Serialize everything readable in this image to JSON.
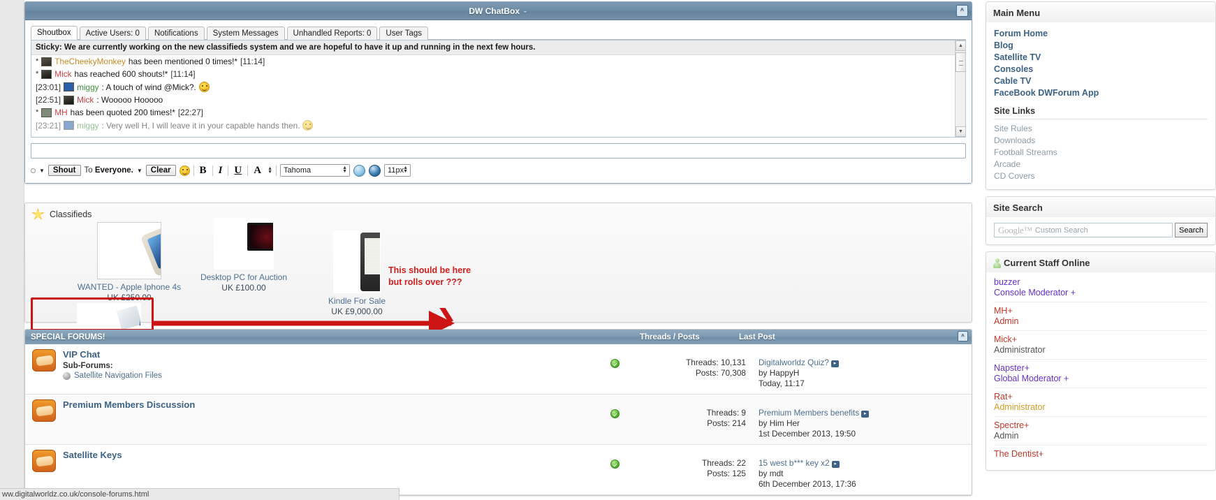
{
  "chatbox": {
    "title": "DW ChatBox",
    "title_caret": "⌄",
    "collapse_label": "^",
    "tabs": [
      {
        "label": "Shoutbox",
        "active": true
      },
      {
        "label": "Active Users: 0",
        "active": false
      },
      {
        "label": "Notifications",
        "active": false
      },
      {
        "label": "System Messages",
        "active": false
      },
      {
        "label": "Unhandled Reports: 0",
        "active": false
      },
      {
        "label": "User Tags",
        "active": false
      }
    ],
    "sticky": "Sticky: We are currently working on the new classifieds system and we are hopeful to have it up and running in the next few hours.",
    "messages": [
      {
        "star": "*",
        "user": "TheCheekyMonkey",
        "text": "has been mentioned 0 times!*",
        "time": "[11:14]"
      },
      {
        "star": "*",
        "user": "Mick",
        "text": "has reached 600 shouts!*",
        "time": "[11:14]"
      },
      {
        "time": "[23:01]",
        "user": "miggy",
        "text": ": A touch of wind @Mick?."
      },
      {
        "time": "[22:51]",
        "user": "Mick",
        "text": ": Wooooo Hooooo"
      },
      {
        "star": "*",
        "user": "MH",
        "text": "has been quoted 200 times!*",
        "time": "[22:27]"
      },
      {
        "time": "[23:21]",
        "user": "miggy",
        "text": ": Very well H, I will leave it in your capable hands then."
      }
    ],
    "input_value": "",
    "input_placeholder": "",
    "toolbar": {
      "shout_label": "Shout",
      "to_label": "To",
      "to_target": "Everyone.",
      "clear_label": "Clear",
      "bold": "B",
      "italic": "I",
      "underline": "U",
      "color": "A",
      "font_value": "Tahoma",
      "size_value": "11px"
    }
  },
  "classifieds": {
    "title": "Classifieds",
    "items": [
      {
        "name": "WANTED - Apple Iphone 4s",
        "price": "UK £250.00",
        "art": "ph-iphone"
      },
      {
        "name": "Desktop PC for Auction",
        "price": "UK £100.00",
        "art": "ph-pc"
      },
      {
        "name": "Kindle For Sale",
        "price": "UK £9,000.00",
        "art": "ph-kindle"
      },
      {
        "name": "",
        "price": "",
        "art": "ph-tab"
      }
    ],
    "annotation_line1": "This should be here",
    "annotation_line2": "but rolls over ???",
    "annotation_color": "#d31e1e"
  },
  "forums": {
    "header_title": "SPECIAL FORUMS!",
    "col_threads_posts": "Threads / Posts",
    "col_last_post": "Last Post",
    "minimize_label": "^",
    "rows": [
      {
        "name": "VIP Chat",
        "sub_label": "Sub-Forums:",
        "sub_items": [
          "Satellite Navigation Files"
        ],
        "threads": "Threads: 10,131",
        "posts": "Posts: 70,308",
        "last_title": "Digitalworldz Quiz?",
        "last_by": "by HappyH",
        "last_time": "Today, 11:17"
      },
      {
        "name": "Premium Members Discussion",
        "sub_label": "",
        "sub_items": [],
        "threads": "Threads: 9",
        "posts": "Posts: 214",
        "last_title": "Premium Members benefits",
        "last_by": "by Him Her",
        "last_time": "1st December 2013, 19:50"
      },
      {
        "name": "Satellite Keys",
        "sub_label": "",
        "sub_items": [],
        "threads": "Threads: 22",
        "posts": "Posts: 125",
        "last_title": "15 west b*** key x2",
        "last_by": "by mdt",
        "last_time": "6th December 2013, 17:36"
      }
    ]
  },
  "sidebar": {
    "main_menu": {
      "title": "Main Menu",
      "items": [
        {
          "label": "Forum Home"
        },
        {
          "label": "Blog"
        },
        {
          "label": "Satellite TV"
        },
        {
          "label": "Consoles"
        },
        {
          "label": "Cable TV"
        },
        {
          "label": "FaceBook DWForum App"
        }
      ],
      "site_links_title": "Site Links",
      "site_links": [
        {
          "label": "Site Rules"
        },
        {
          "label": "Downloads"
        },
        {
          "label": "Football Streams"
        },
        {
          "label": "Arcade"
        },
        {
          "label": "CD Covers"
        }
      ]
    },
    "site_search": {
      "title": "Site Search",
      "google_logo": "Google™",
      "placeholder": "Custom Search",
      "button_label": "Search"
    },
    "staff_online": {
      "title": "Current Staff Online",
      "members": [
        {
          "name": "buzzer",
          "role": "Console Moderator +",
          "name_color": "c-purple",
          "role_color": "c-purple"
        },
        {
          "name": "MH+",
          "role": "Admin",
          "name_color": "c-red",
          "role_color": "c-red"
        },
        {
          "name": "Mick+",
          "role": "Administrator",
          "name_color": "c-red",
          "role_color": "c-grey"
        },
        {
          "name": "Napster+",
          "role": "Global Moderator +",
          "name_color": "c-purple",
          "role_color": "c-purple"
        },
        {
          "name": "Rat+",
          "role": "Administrator",
          "name_color": "c-red",
          "role_color": "c-orange"
        },
        {
          "name": "Spectre+",
          "role": "Admin",
          "name_color": "c-red",
          "role_color": "c-grey"
        },
        {
          "name": "The Dentist+",
          "role": "",
          "name_color": "c-red",
          "role_color": "c-grey"
        }
      ]
    }
  },
  "statusbar": {
    "url": "ww.digitalworldz.co.uk/console-forums.html"
  }
}
